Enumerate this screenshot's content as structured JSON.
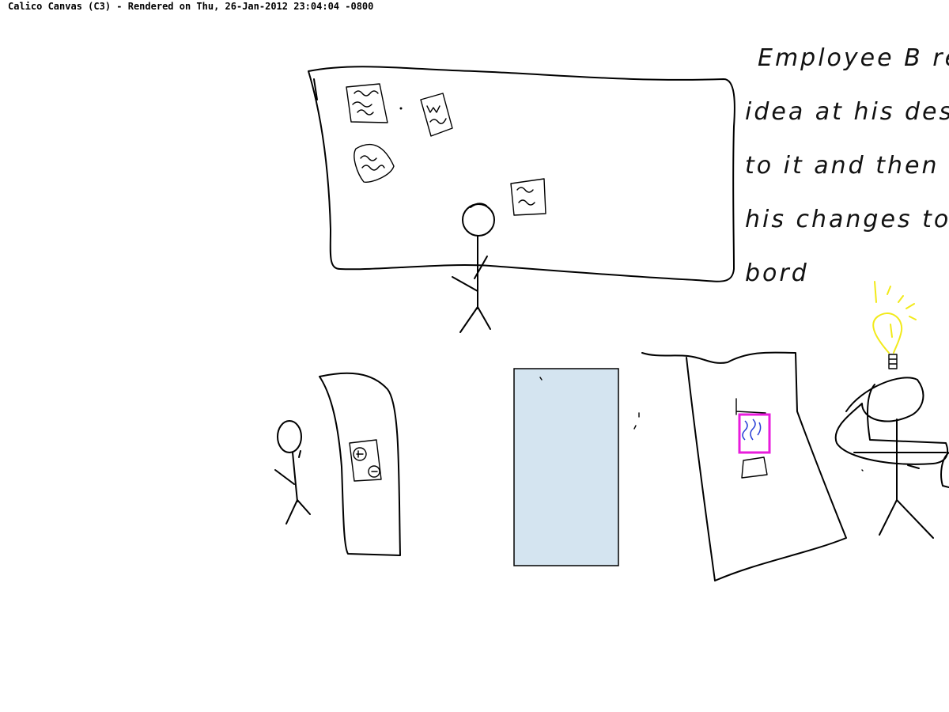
{
  "header": {
    "title": "Calico Canvas (C3) - Rendered on Thu, 26-Jan-2012 23:04:04 -0800"
  },
  "note": {
    "lines": [
      "Employee B reviews",
      "idea at his desk, a",
      "to it and then u",
      "his changes to the",
      "bord"
    ]
  },
  "canvas": {
    "background": "#ffffff",
    "ink_color": "#000000",
    "door_fill": "#d4e4f0",
    "bulb_color": "#f2ea1a",
    "highlight_color": "#e81cdc",
    "highlight_inner_color": "#2a40d6"
  }
}
